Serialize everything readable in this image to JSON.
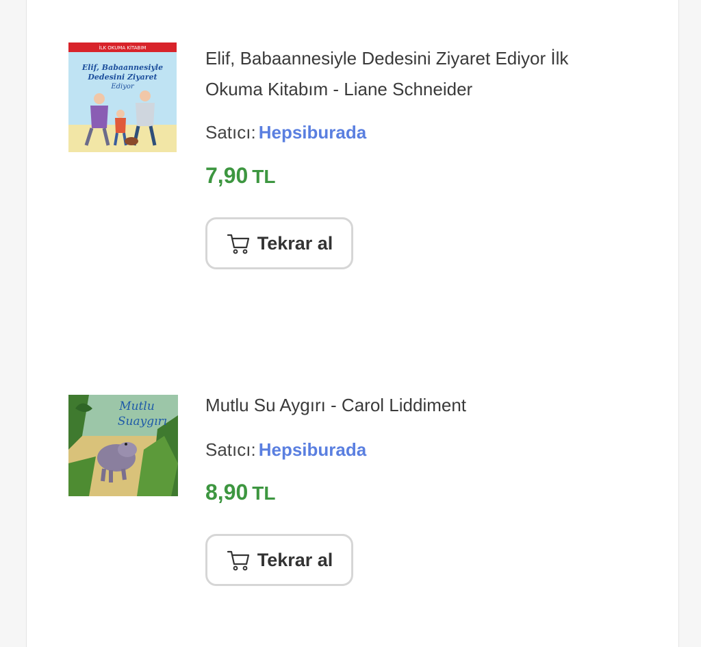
{
  "orders": [
    {
      "title": "Elif, Babaannesiyle Dedesini Ziyaret Ediyor İlk Okuma Kitabım - Liane Schneider",
      "seller_label": "Satıcı:",
      "seller_name": "Hepsiburada",
      "price_value": "7,90",
      "price_currency": "TL",
      "button_label": "Tekrar al",
      "cover": {
        "banner": "İLK OKUMA KİTABIM",
        "line1": "Elif, Babaannesiyle",
        "line2": "Dedesini Ziyaret",
        "line3": "Ediyor"
      }
    },
    {
      "title": "Mutlu Su Aygırı - Carol Liddiment",
      "seller_label": "Satıcı:",
      "seller_name": "Hepsiburada",
      "price_value": "8,90",
      "price_currency": "TL",
      "button_label": "Tekrar al",
      "cover": {
        "line1": "Mutlu",
        "line2": "Suaygırı"
      }
    }
  ],
  "colors": {
    "price": "#3d9640",
    "seller": "#5a7fe0",
    "button_border": "#d6d6d6"
  },
  "icons": {
    "cart": "shopping-cart-icon"
  }
}
